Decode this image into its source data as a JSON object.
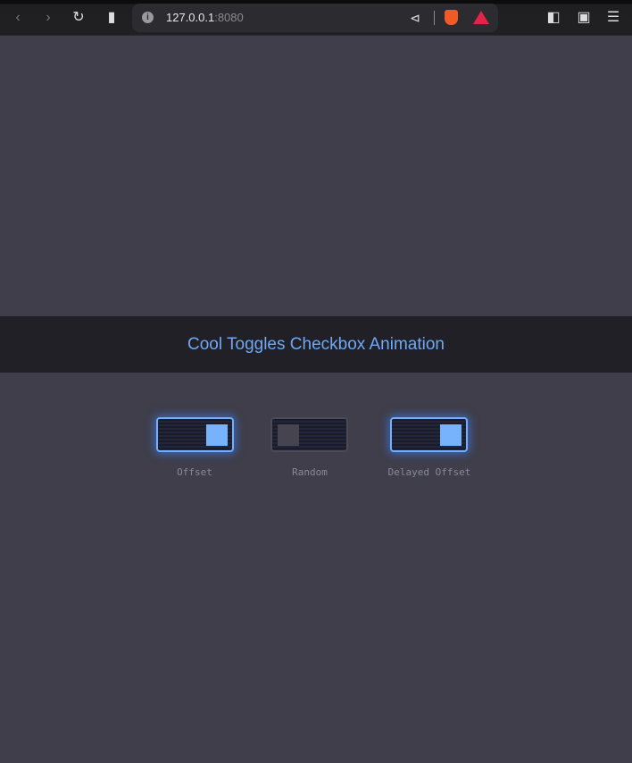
{
  "browser": {
    "url_host": "127.0.0.1",
    "url_port": ":8080",
    "info_icon": "i"
  },
  "page": {
    "title": "Cool Toggles Checkbox Animation"
  },
  "toggles": [
    {
      "label": "Offset",
      "checked": true
    },
    {
      "label": "Random",
      "checked": false
    },
    {
      "label": "Delayed Offset",
      "checked": true
    }
  ],
  "colors": {
    "accent": "#74aefc",
    "background": "#3f3e4a",
    "header_bg": "#202026"
  }
}
